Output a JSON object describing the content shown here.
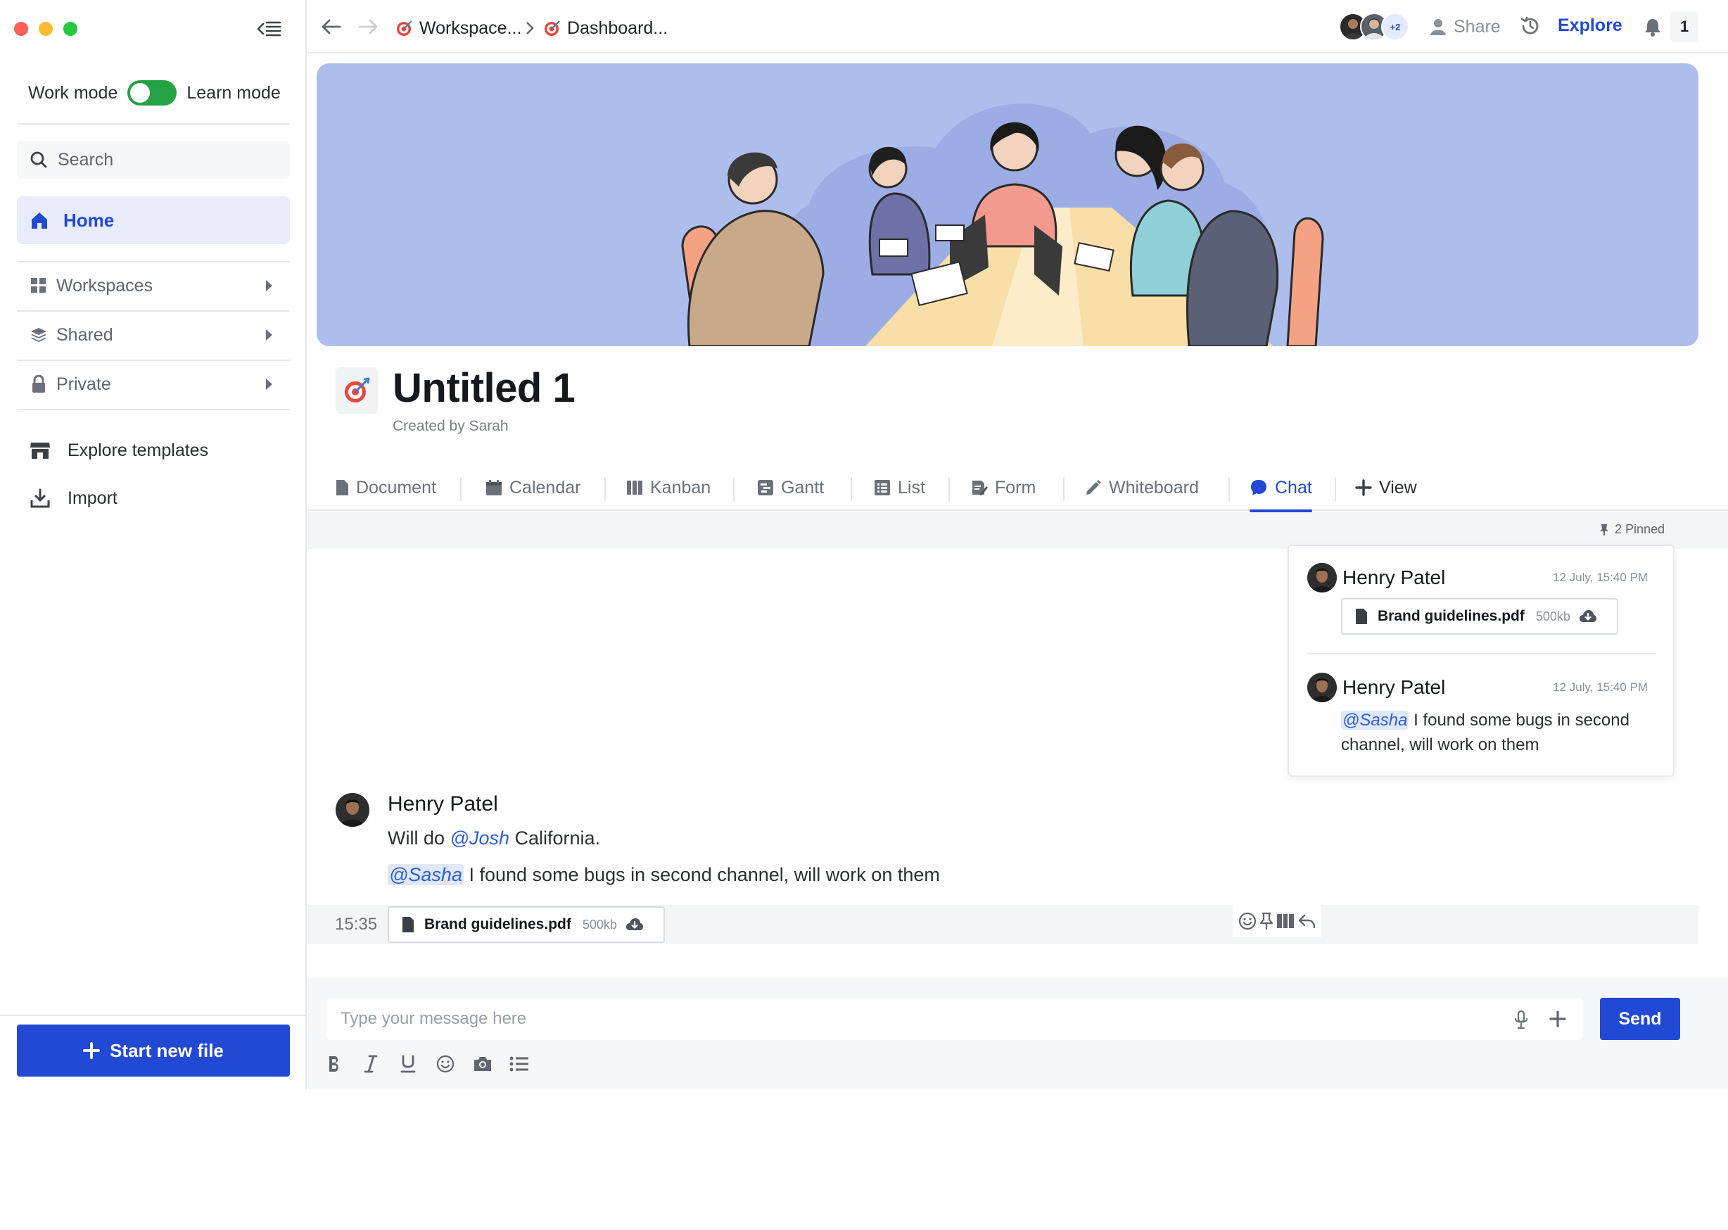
{
  "sidebar": {
    "mode_left": "Work mode",
    "mode_right": "Learn mode",
    "search_label": "Search",
    "home_label": "Home",
    "sections": [
      {
        "label": "Workspaces"
      },
      {
        "label": "Shared"
      },
      {
        "label": "Private"
      }
    ],
    "explore_templates": "Explore templates",
    "import": "Import",
    "start_new_file": "Start new file"
  },
  "topbar": {
    "crumb1": "Workspace...",
    "crumb2": "Dashboard...",
    "avatars_more": "+2",
    "share": "Share",
    "explore": "Explore",
    "notifications": "1"
  },
  "page": {
    "title": "Untitled 1",
    "created_by": "Created by Sarah"
  },
  "tabs": [
    {
      "label": "Document"
    },
    {
      "label": "Calendar"
    },
    {
      "label": "Kanban"
    },
    {
      "label": "Gantt"
    },
    {
      "label": "List"
    },
    {
      "label": "Form"
    },
    {
      "label": "Whiteboard"
    },
    {
      "label": "Chat"
    },
    {
      "label": "View"
    }
  ],
  "chat": {
    "pinned_label": "2 Pinned",
    "pinned": [
      {
        "author": "Henry Patel",
        "time": "12 July, 15:40 PM",
        "file_name": "Brand guidelines.pdf",
        "file_size": "500kb"
      },
      {
        "author": "Henry Patel",
        "time": "12 July, 15:40 PM",
        "mention": "@Sasha",
        "text": "I found some bugs in second channel, will work on them"
      }
    ],
    "message": {
      "author": "Henry Patel",
      "line1_prefix": "Will do",
      "line1_mention": "@Josh",
      "line1_suffix": "California.",
      "line2_mention": "@Sasha",
      "line2_text": "I found some bugs in second channel, will work on them",
      "time": "15:35",
      "file_name": "Brand guidelines.pdf",
      "file_size": "500kb"
    },
    "composer": {
      "placeholder": "Type your message here",
      "send": "Send"
    }
  },
  "colors": {
    "accent": "#2149d3",
    "toggle_on": "#25a244",
    "banner_bg": "#aebeec"
  }
}
